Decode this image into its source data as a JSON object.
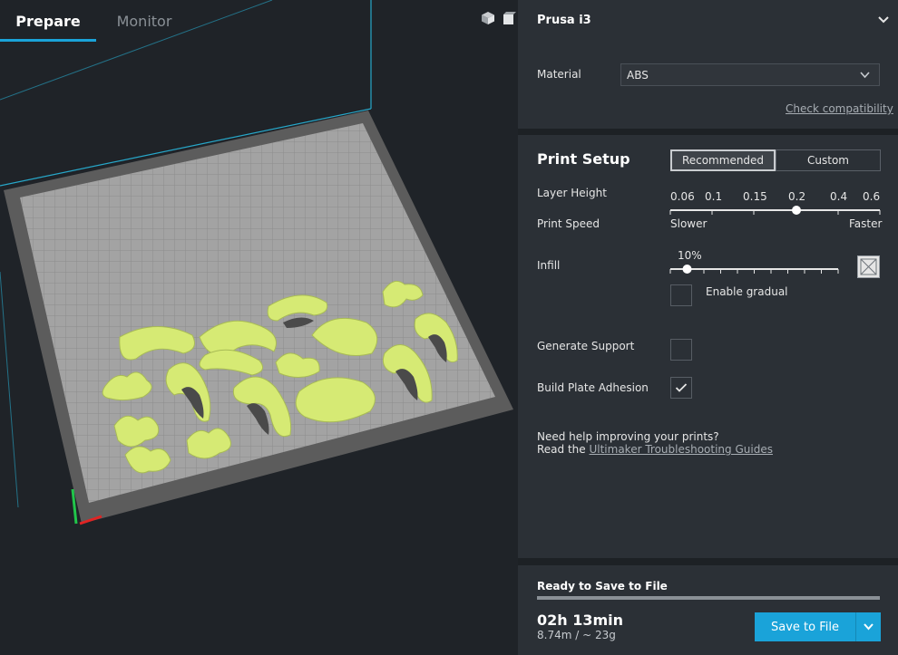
{
  "tabs": [
    {
      "label": "Prepare",
      "active": true
    },
    {
      "label": "Monitor",
      "active": false
    }
  ],
  "view_icons": [
    "3d-view-icon",
    "front-view-icon"
  ],
  "machine": {
    "name": "Prusa i3",
    "material_label": "Material",
    "material_value": "ABS",
    "check_compat": "Check compatibility"
  },
  "print_setup": {
    "title": "Print Setup",
    "mode_recommended": "Recommended",
    "mode_custom": "Custom",
    "layer_height_label": "Layer Height",
    "layer_heights": [
      "0.06",
      "0.1",
      "0.15",
      "0.2",
      "0.4",
      "0.6"
    ],
    "selected_layer_height": "0.2",
    "print_speed_label": "Print Speed",
    "slower": "Slower",
    "faster": "Faster",
    "infill_label": "Infill",
    "infill_value": "10%",
    "infill_fraction": 0.1,
    "enable_gradual": "Enable gradual",
    "enable_gradual_checked": false,
    "generate_support": "Generate Support",
    "generate_support_checked": false,
    "build_plate_adhesion": "Build Plate Adhesion",
    "build_plate_adhesion_checked": true,
    "help_line1": "Need help improving your prints?",
    "help_line2_prefix": "Read the ",
    "help_link": "Ultimaker Troubleshooting Guides"
  },
  "save": {
    "status": "Ready to Save to File",
    "time": "02h 13min",
    "material_estimate": "8.74m / ~ 23g",
    "button_label": "Save to File"
  },
  "colors": {
    "accent": "#1aa3d9",
    "model": "#d6ea74",
    "plate": "#9c9c9c",
    "panel": "#2b3036"
  }
}
